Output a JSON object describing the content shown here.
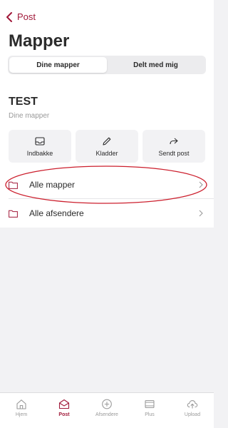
{
  "header": {
    "back_label": "Post",
    "title": "Mapper"
  },
  "segments": [
    {
      "label": "Dine mapper",
      "active": true
    },
    {
      "label": "Delt med mig",
      "active": false
    }
  ],
  "account": {
    "title": "TEST",
    "subtitle": "Dine mapper"
  },
  "quick_actions": [
    {
      "label": "Indbakke",
      "icon": "inbox-icon"
    },
    {
      "label": "Kladder",
      "icon": "pencil-icon"
    },
    {
      "label": "Sendt post",
      "icon": "share-arrow-icon"
    }
  ],
  "rows": [
    {
      "label": "Alle mapper",
      "icon": "folder-icon"
    },
    {
      "label": "Alle afsendere",
      "icon": "folder-icon"
    }
  ],
  "tabbar": [
    {
      "label": "Hjem",
      "icon": "home-icon",
      "active": false
    },
    {
      "label": "Post",
      "icon": "envelope-icon",
      "active": true
    },
    {
      "label": "Afsendere",
      "icon": "plus-circle-icon",
      "active": false
    },
    {
      "label": "Plus",
      "icon": "tray-icon",
      "active": false
    },
    {
      "label": "Upload",
      "icon": "cloud-upload-icon",
      "active": false
    }
  ],
  "colors": {
    "accent": "#a11a3a",
    "annotation": "#cc1f2d",
    "background": "#f2f2f4"
  }
}
